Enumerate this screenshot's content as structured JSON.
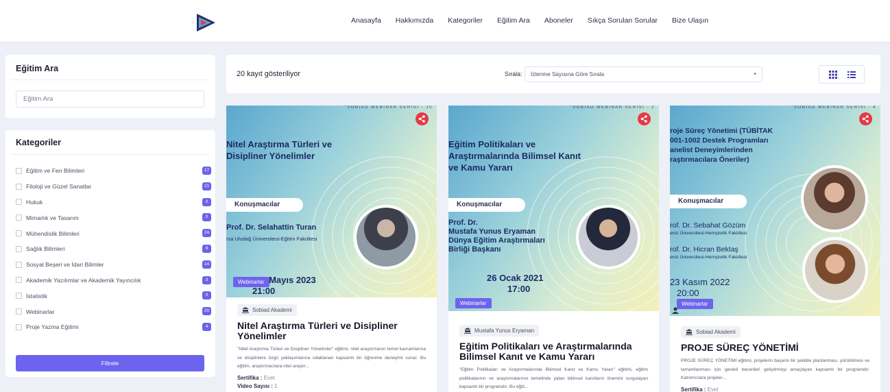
{
  "nav": {
    "items": [
      "Anasayfa",
      "Hakkımızda",
      "Kategoriler",
      "Eğitim Ara",
      "Aboneler",
      "Sıkça Sorulan Sorular",
      "Bize Ulaşın"
    ]
  },
  "sidebar": {
    "search_title": "Eğitim Ara",
    "search_placeholder": "Eğitim Ara",
    "categories_title": "Kategoriler",
    "categories": [
      {
        "label": "Eğitim ve Fen Bilimleri",
        "count": "17"
      },
      {
        "label": "Filoloji ve Güzel Sanatlar",
        "count": "21"
      },
      {
        "label": "Hukuk",
        "count": "0"
      },
      {
        "label": "Mimarlık ve Tasarım",
        "count": "0"
      },
      {
        "label": "Mühendislik Bilimleri",
        "count": "24"
      },
      {
        "label": "Sağlık Bilimleri",
        "count": "9"
      },
      {
        "label": "Sosyal Beşeri ve İdari Bilimler",
        "count": "14"
      },
      {
        "label": "Akademik Yazılımlar ve Akademik Yayıncılık",
        "count": "3"
      },
      {
        "label": "İstatistik",
        "count": "0"
      },
      {
        "label": "Webinarlar",
        "count": "20"
      },
      {
        "label": "Proje Yazma Eğitimi",
        "count": "4"
      }
    ],
    "filter_button": "Filtrele"
  },
  "toolbar": {
    "count_text": "20 kayıt gösteriliyor",
    "sort_label": "Sırala:",
    "sort_value": "İzlenme Sayısına Göre Sırala"
  },
  "cards": [
    {
      "series": "\"SOBIAD WEBINAR SERİSİ - 10",
      "img_title_1": "Nitel Araştırma Türleri ve",
      "img_title_2": "Disipliner Yönelimler",
      "speakers_label": "Konuşmacılar",
      "speaker_1": "Prof. Dr. Selahattin Turan",
      "speaker_1_aff": "rsa Uludağ Üniversitesi-Eğitim Fakültesi",
      "img_date": "05 Mayıs 2023",
      "img_time": "21:00",
      "tag": "Webinarlar",
      "author": "Sobiad Akademi",
      "title": "Nitel Araştırma Türleri ve Disipliner Yönelimler",
      "desc": "\"Nitel Araştırma Türleri ve Disipliner Yönelimler\" eğitimi, nitel araştırmanın temel kavramlarına ve disiplinlere özgü yaklaşımlarına odaklanan kapsamlı bir öğrenme deneyimi sunar. Bu eğitim, araştırmacılara nitel araştır...",
      "cert_label": "Sertifika :",
      "cert_value": "Evet",
      "video_label": "Video Sayısı :",
      "video_value": "1"
    },
    {
      "series": "\"SOBIAD WEBINAR SERİSİ - 2",
      "img_title_1": "Eğitim Politikaları ve",
      "img_title_2": "Araştırmalarında Bilimsel Kanıt",
      "img_title_3": "ve Kamu Yararı",
      "speakers_label": "Konuşmacılar",
      "speaker_1": "Prof. Dr.",
      "speaker_1b": "Mustafa Yunus Eryaman",
      "speaker_1c": "Dünya Eğitim Araştırmaları",
      "speaker_1d": "Birliği Başkanı",
      "img_date": "26 Ocak 2021",
      "img_time": "17:00",
      "tag": "Webinarlar",
      "author": "Mustafa Yunus Eryaman",
      "title": "Eğitim Politikaları ve Araştırmalarında Bilimsel Kanıt ve Kamu Yararı",
      "desc": "\"Eğitim Politikaları ve Araştırmalarında Bilimsel Kanıt ve Kamu Yararı\" eğitimi, eğitim politikalarının ve araştırmalarının temelinde yatan bilimsel kanıtların önemini vurgulayan kapsamlı bir programdır. Bu eğiti..."
    },
    {
      "series": "\"SOBIAD WEBINAR SERİSİ - 4",
      "img_title_1": "roje Süreç Yönetimi (TÜBİTAK",
      "img_title_2": "001-1002 Destek Programları",
      "img_title_3": "anelist Deneyimlerinden",
      "img_title_4": "raştırmacılara Öneriler)",
      "speakers_label": "Konuşmacılar",
      "speaker_1": "rof. Dr. Sebahat Gözüm",
      "speaker_1_aff": "eniz Üniversitesi-Hemşirelik Fakültesi",
      "speaker_2": "rof. Dr. Hicran Bektaş",
      "speaker_2_aff": "eniz Üniversitesi-Hemşirelik Fakültesi",
      "img_date": "23 Kasım 2022",
      "img_time": "20:00",
      "tag": "Webinarlar",
      "author": "Sobiad Akademi",
      "title": "PROJE SÜREÇ YÖNETİMİ",
      "desc": "PROJE SÜREÇ YÖNETİMİ eğitimi, projelerin başarılı bir şekilde planlanması, yürütülmesi ve tamamlanması için gerekli becerileri geliştirmeyi amaçlayan kapsamlı bir programdır. Katılımcılara projeler...",
      "cert_label": "Sertifika :",
      "cert_value": "Evet"
    }
  ],
  "colors": {
    "accent": "#6c63ee",
    "share": "#e63946",
    "title_navy": "#1c2b64"
  }
}
